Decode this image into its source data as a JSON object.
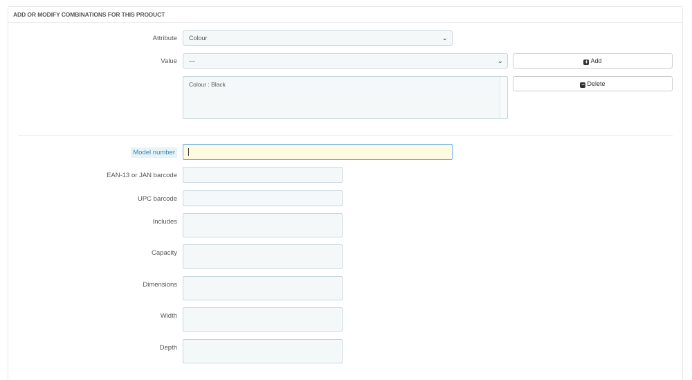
{
  "panel": {
    "title": "ADD OR MODIFY COMBINATIONS FOR THIS PRODUCT"
  },
  "attribute": {
    "label": "Attribute",
    "selected": "Colour"
  },
  "value": {
    "label": "Value",
    "selected": "---"
  },
  "buttons": {
    "add": "Add",
    "delete": "Delete"
  },
  "combinations": {
    "items": [
      "Colour : Black"
    ]
  },
  "fields": {
    "model_number": {
      "label": "Model number",
      "value": ""
    },
    "ean13": {
      "label": "EAN-13 or JAN barcode",
      "value": ""
    },
    "upc": {
      "label": "UPC barcode",
      "value": ""
    },
    "includes": {
      "label": "Includes",
      "value": ""
    },
    "capacity": {
      "label": "Capacity",
      "value": ""
    },
    "dimensions": {
      "label": "Dimensions",
      "value": ""
    },
    "width": {
      "label": "Width",
      "value": ""
    },
    "depth": {
      "label": "Depth",
      "value": ""
    }
  },
  "icons": {
    "add": "plus-square-icon",
    "delete": "minus-square-icon",
    "dropdown": "chevron-down-icon"
  }
}
